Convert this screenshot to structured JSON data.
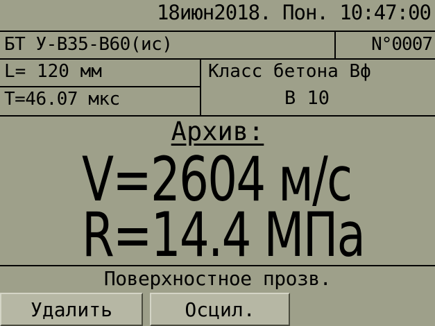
{
  "header": {
    "datetime": "18июн2018. Пон. 10:47:00"
  },
  "device": {
    "model": "БТ У-В35-В60(ис)",
    "serial": "N°0007"
  },
  "params": {
    "length": "L= 120 мм",
    "time": "T=46.07 мкс",
    "concrete_class_label": "Класс бетона Вф",
    "concrete_class_value": "В 10"
  },
  "archive": {
    "title": "Архив:",
    "velocity": "V=2604 м/с",
    "strength": "R=14.4 МПа"
  },
  "status": {
    "mode": "Поверхностное прозв."
  },
  "buttons": {
    "delete_label": "Удалить",
    "oscil_label": "Осцил."
  },
  "colors": {
    "screen_bg": "#9ea08a",
    "button_bg": "#b6b7a4",
    "text": "#000000"
  }
}
